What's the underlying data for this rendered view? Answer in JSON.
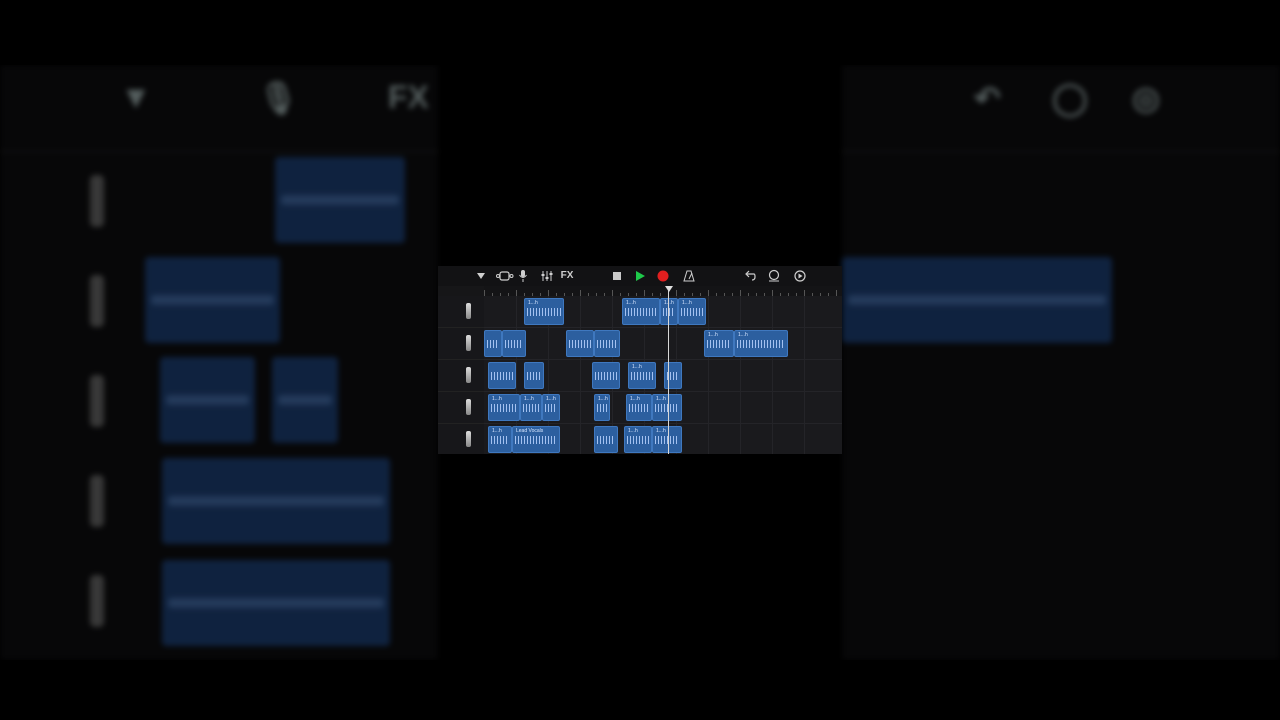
{
  "toolbar": {
    "fx_label": "FX"
  },
  "icons": {
    "track_view": "dropdown-triangle-icon",
    "browser": "browser-icon",
    "mic": "microphone-icon",
    "mixer": "mixer-icon",
    "stop": "stop-icon",
    "play": "play-icon",
    "record": "record-icon",
    "metronome": "metronome-icon",
    "undo": "undo-icon",
    "loop": "loop-icon",
    "settings": "settings-icon"
  },
  "colors": {
    "play": "#1ec94a",
    "record": "#e01f1f",
    "region": "#2c5f9f"
  },
  "tracks": [
    {
      "regions": [
        {
          "label": "1...h"
        },
        {
          "label": "1...h"
        },
        {
          "label": "1...h"
        },
        {
          "label": "1...h"
        }
      ]
    },
    {
      "regions": [
        {
          "label": ""
        },
        {
          "label": ""
        },
        {
          "label": ""
        },
        {
          "label": ""
        },
        {
          "label": "1...h"
        },
        {
          "label": "1...h"
        }
      ]
    },
    {
      "regions": [
        {
          "label": ""
        },
        {
          "label": ""
        },
        {
          "label": ""
        },
        {
          "label": "1...h"
        },
        {
          "label": ""
        }
      ]
    },
    {
      "regions": [
        {
          "label": "1...h"
        },
        {
          "label": "1...h"
        },
        {
          "label": "1...h"
        },
        {
          "label": "1...h"
        },
        {
          "label": "1...h"
        },
        {
          "label": "1...h"
        }
      ]
    },
    {
      "regions": [
        {
          "label": "1...h"
        },
        {
          "label": "Lead Vocals"
        },
        {
          "label": ""
        },
        {
          "label": "1...h"
        },
        {
          "label": "1...h"
        }
      ]
    }
  ],
  "background": {
    "fx_label": "FX",
    "regions": [
      {
        "label": "1...h"
      },
      {
        "label": "1...h"
      },
      {
        "label": "1...h"
      },
      {
        "label": "Lead Vocals"
      }
    ]
  }
}
